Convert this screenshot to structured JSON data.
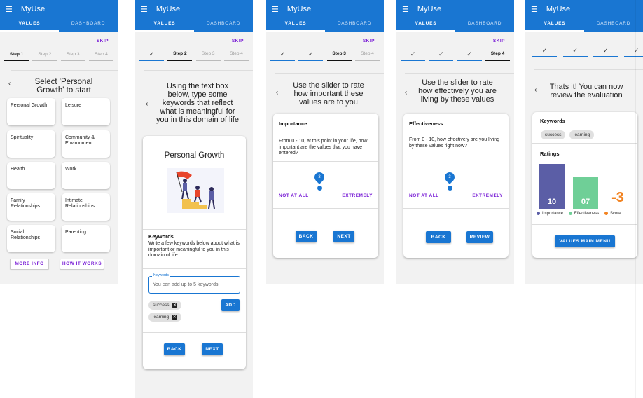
{
  "app_title": "MyUse",
  "tabs": {
    "values": "VALUES",
    "dashboard": "DASHBOARD"
  },
  "skip_label": "SKIP",
  "steps": [
    "Step 1",
    "Step 2",
    "Step 3",
    "Step 4"
  ],
  "done_mark": "✓",
  "screen1": {
    "prompt": "Select 'Personal Growth' to start",
    "categories": [
      "Personal Growth",
      "Leisure",
      "Spirituality",
      "Community & Environment",
      "Health",
      "Work",
      "Family Relationships",
      "Intimate Relationships",
      "Social Relationships",
      "Parenting"
    ],
    "more_info": "MORE INFO",
    "how_it_works": "HOW IT WORKS"
  },
  "screen2": {
    "prompt": "Using the text box below, type some keywords that reflect what is meaningful for you in this domain of life",
    "domain_title": "Personal Growth",
    "keywords_title": "Keywords",
    "keywords_text": "Write a few keywords below about what is important or meaningful to you in this domain of life.",
    "field_label": "Keywords",
    "field_placeholder": "You can add up to 5 keywords",
    "add_label": "ADD",
    "chips": [
      "success",
      "learning"
    ],
    "back_label": "BACK",
    "next_label": "NEXT"
  },
  "screen3": {
    "prompt": "Use the slider to rate how important these values are to you",
    "card_title": "Importance",
    "card_text": "From 0 - 10, at this point in your life, how important are the values that you have entered?",
    "slider_value": "3",
    "slider_level": 0.3,
    "min_label": "NOT AT ALL",
    "max_label": "EXTREMELY",
    "back_label": "BACK",
    "next_label": "NEXT"
  },
  "screen4": {
    "prompt": "Use the slider to rate how effectively you are living by these values",
    "card_title": "Effectiveness",
    "card_text": "From 0 - 10, how effectively are you living by these values right now?",
    "slider_value": "3",
    "slider_level": 0.3,
    "min_label": "NOT AT ALL",
    "max_label": "EXTREMELY",
    "back_label": "BACK",
    "review_label": "REVIEW"
  },
  "screen5": {
    "prompt": "Thats it! You can now review the evaluation",
    "keywords_title": "Keywords",
    "chips": [
      "success",
      "learning"
    ],
    "ratings_title": "Ratings",
    "importance_value": "10",
    "effectiveness_value": "07",
    "score_value": "-3",
    "legend": [
      "Importance",
      "Effectiveness",
      "Score"
    ],
    "colors": {
      "importance": "#5b5ea6",
      "effectiveness": "#6fcf97",
      "score": "#f2821f"
    },
    "main_menu_label": "VALUES MAIN MENU"
  },
  "chart_data": {
    "type": "bar",
    "categories": [
      "Importance",
      "Effectiveness",
      "Score"
    ],
    "values": [
      10,
      7,
      -3
    ],
    "ylim": [
      0,
      10
    ]
  }
}
